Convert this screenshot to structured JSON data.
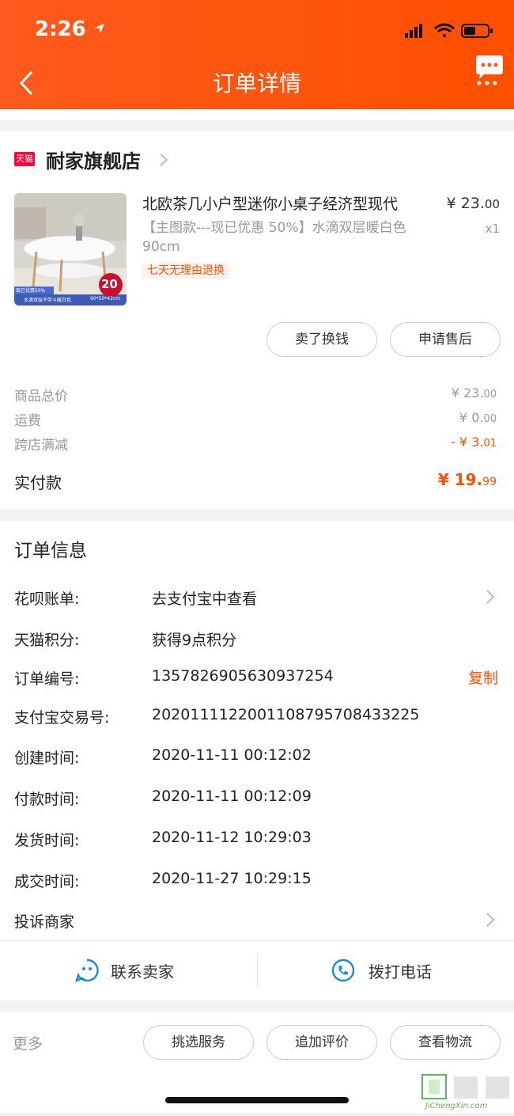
{
  "status_bar": {
    "time": "2:26"
  },
  "nav": {
    "title": "订单详情"
  },
  "shop": {
    "badge": "天猫",
    "name": "耐家旗舰店"
  },
  "product": {
    "title": "北欧茶几小户型迷你小桌子经济型现代",
    "sku": "【主图款---现已优惠 50%】水滴双层暖白色 90cm",
    "tag": "七天无理由退换",
    "price_main": "¥ 23.",
    "price_cents": "00",
    "qty": "x1",
    "img_badge": "20",
    "img_caption_left": "水滴双层不带斗暖白色",
    "img_caption_right": "90*50*42cm",
    "img_promo": "现已优惠50%"
  },
  "item_actions": {
    "sell": "卖了换钱",
    "after_sale": "申请售后"
  },
  "fees": [
    {
      "label": "商品总价",
      "main": "¥ 23.",
      "cents": "00",
      "color": "#999999"
    },
    {
      "label": "运费",
      "main": "¥ 0.",
      "cents": "00",
      "color": "#999999"
    },
    {
      "label": "跨店满减",
      "main": "- ¥ 3.",
      "cents": "01",
      "color": "#ff5000"
    }
  ],
  "total": {
    "label": "实付款",
    "main": "¥ 19.",
    "cents": "99"
  },
  "order_info": {
    "title": "订单信息",
    "rows": [
      {
        "label": "花呗账单:",
        "value": "去支付宝中查看"
      },
      {
        "label": "天猫积分:",
        "value": "获得9点积分"
      },
      {
        "label": "订单编号:",
        "value": "1357826905630937254"
      },
      {
        "label": "支付宝交易号:",
        "value": "2020111122001108795708433225"
      },
      {
        "label": "创建时间:",
        "value": "2020-11-11 00:12:02"
      },
      {
        "label": "付款时间:",
        "value": "2020-11-11 00:12:09"
      },
      {
        "label": "发货时间:",
        "value": "2020-11-12 10:29:03"
      },
      {
        "label": "成交时间:",
        "value": "2020-11-27 10:29:15"
      }
    ],
    "copy_label": "复制",
    "complaint": "投诉商家"
  },
  "contact": {
    "seller": "联系卖家",
    "phone": "拨打电话"
  },
  "bottom": {
    "more": "更多",
    "buttons": [
      "挑选服务",
      "追加评价",
      "查看物流"
    ]
  },
  "watermark": {
    "text": "JiChengXin.com"
  },
  "colors": {
    "brand": "#ff5000",
    "header": "#ff5a1e",
    "tmall": "#ff0036"
  }
}
